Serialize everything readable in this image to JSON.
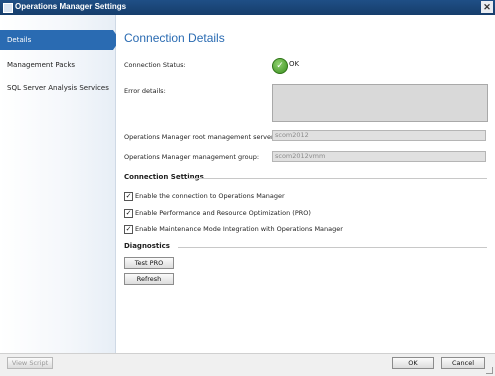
{
  "window": {
    "title": "Operations Manager Settings"
  },
  "sidebar": {
    "items": [
      {
        "label": "Details"
      },
      {
        "label": "Management Packs"
      },
      {
        "label": "SQL Server Analysis Services"
      }
    ]
  },
  "main": {
    "title": "Connection Details",
    "connection_status_label": "Connection Status:",
    "connection_status_value": "OK",
    "error_details_label": "Error details:",
    "root_server_label": "Operations Manager root management server:",
    "root_server_value": "scom2012",
    "management_group_label": "Operations Manager management group:",
    "management_group_value": "scom2012vmm",
    "connection_settings_heading": "Connection Settings",
    "checkboxes": [
      {
        "label": "Enable the connection to Operations Manager",
        "checked": true
      },
      {
        "label": "Enable Performance and Resource Optimization (PRO)",
        "checked": true
      },
      {
        "label": "Enable Maintenance Mode Integration with Operations Manager",
        "checked": true
      }
    ],
    "diagnostics_heading": "Diagnostics",
    "test_pro_label": "Test PRO",
    "refresh_label": "Refresh"
  },
  "footer": {
    "view_script_label": "View Script",
    "ok_label": "OK",
    "cancel_label": "Cancel"
  },
  "colors": {
    "accent": "#2a6bb2",
    "titlebar": "#1f4f86",
    "status_ok": "#3b8f20"
  }
}
